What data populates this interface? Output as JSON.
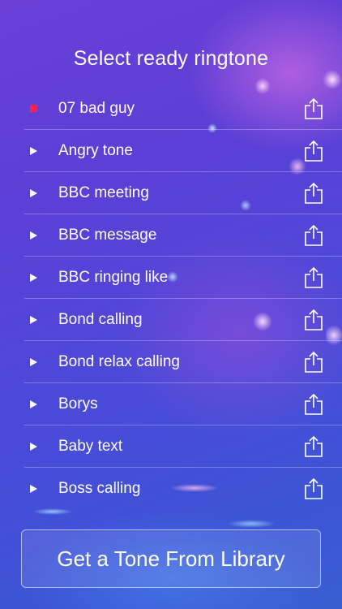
{
  "title": "Select ready ringtone",
  "ringtones": [
    {
      "name": "07 bad guy",
      "state": "playing"
    },
    {
      "name": "Angry tone",
      "state": "stopped"
    },
    {
      "name": "BBC meeting",
      "state": "stopped"
    },
    {
      "name": "BBC message",
      "state": "stopped"
    },
    {
      "name": "BBC ringing like",
      "state": "stopped"
    },
    {
      "name": "Bond calling",
      "state": "stopped"
    },
    {
      "name": "Bond relax calling",
      "state": "stopped"
    },
    {
      "name": "Borys",
      "state": "stopped"
    },
    {
      "name": "Baby text",
      "state": "stopped"
    },
    {
      "name": "Boss calling",
      "state": "stopped"
    }
  ],
  "library_button": "Get a Tone From Library",
  "colors": {
    "stop_indicator": "#ff1f4b"
  }
}
